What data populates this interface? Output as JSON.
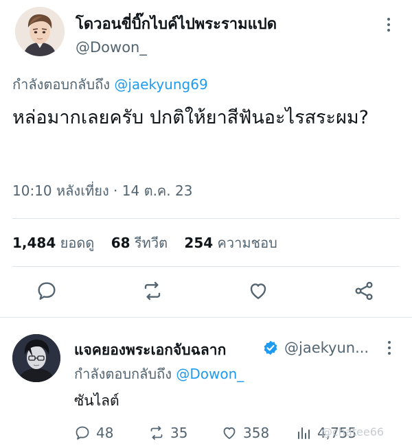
{
  "main_tweet": {
    "author_name": "โดวอนขี่บิ๊กไบค์ไปพระรามแปด",
    "author_handle": "@Dowon_",
    "replying_prefix": "กำลังตอบกลับถึง",
    "replying_mention": "@jaekyung69",
    "text": "หล่อมากเลยครับ ปกติให้ยาสีฟันอะไรสระผม?",
    "timestamp": "10:10 หลังเที่ยง · 14 ต.ค. 23",
    "stats": {
      "views_count": "1,484",
      "views_label": "ยอดดู",
      "retweets_count": "68",
      "retweets_label": "รีทวีต",
      "likes_count": "254",
      "likes_label": "ความชอบ"
    },
    "actions": [
      "reply-icon",
      "retweet-icon",
      "like-icon",
      "share-icon"
    ]
  },
  "reply_tweet": {
    "author_name": "แจคยองพระเอกจับฉลาก",
    "verified": true,
    "author_handle": "@jaekyun...",
    "replying_prefix": "กำลังตอบกลับถึง",
    "replying_mention": "@Dowon_",
    "text": "ซันไลต์",
    "actions": {
      "replies": "48",
      "retweets": "35",
      "likes": "358",
      "views": "4,755"
    },
    "watermark": "@chatee66"
  },
  "colors": {
    "text": "#0f1419",
    "secondary": "#536471",
    "link": "#1d9bf0",
    "divider": "#dfe4e8"
  }
}
